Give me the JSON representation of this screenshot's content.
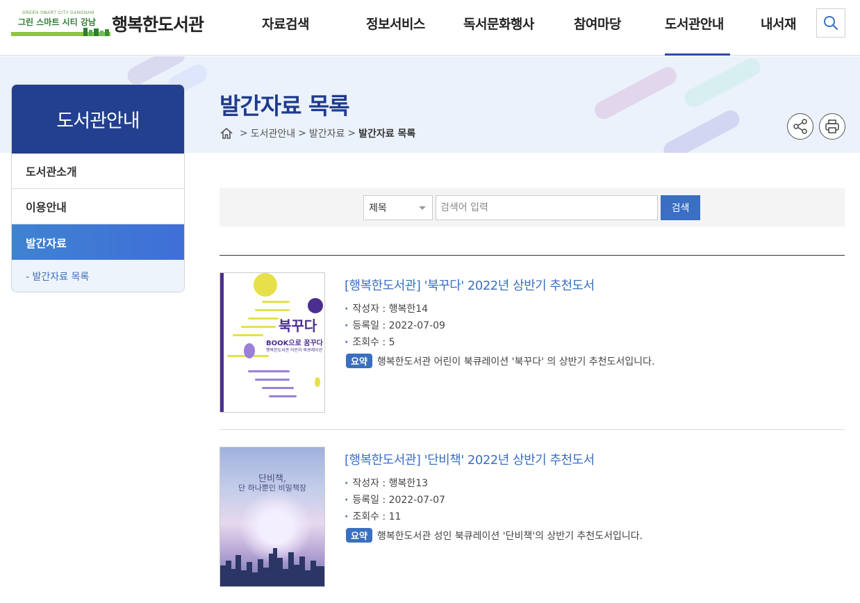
{
  "header": {
    "logo_sub": "GREEN SMART CITY GANGNAM",
    "logo_badge": "그린 스마트 시티 강남",
    "logo_name": "행복한도서관",
    "nav": [
      {
        "label": "자료검색"
      },
      {
        "label": "정보서비스"
      },
      {
        "label": "독서문화행사"
      },
      {
        "label": "참여마당"
      },
      {
        "label": "도서관안내"
      },
      {
        "label": "내서재"
      }
    ],
    "active_nav": "도서관안내"
  },
  "banner": {
    "title": "발간자료 목록",
    "breadcrumb": [
      "도서관안내",
      "발간자료",
      "발간자료 목록"
    ]
  },
  "sidebar": {
    "title": "도서관안내",
    "items": [
      {
        "label": "도서관소개"
      },
      {
        "label": "이용안내"
      },
      {
        "label": "발간자료"
      }
    ],
    "sub_item": "- 발간자료 목록"
  },
  "search": {
    "select_value": "제목",
    "placeholder": "검색어 입력",
    "button": "검색"
  },
  "list": [
    {
      "title": "[행복한도서관] '북꾸다' 2022년 상반기 추천도서",
      "author": "작성자 : 행복한14",
      "date": "등록일 : 2022-07-09",
      "views": "조회수 : 5",
      "badge": "요약",
      "summary": "행복한도서관 어린이 북큐레이션 '북꾸다' 의 상반기 추천도서입니다.",
      "cover_big": "북꾸다",
      "cover_line1": "BOOK으로 꿈꾸다",
      "cover_line2": "행복한도서관 어린이 북큐레이션"
    },
    {
      "title": "[행복한도서관] '단비책' 2022년 상반기 추천도서",
      "author": "작성자 : 행복한13",
      "date": "등록일 : 2022-07-07",
      "views": "조회수 : 11",
      "badge": "요약",
      "summary": "행복한도서관 성인 북큐레이션 '단비책'의 상반기 추천도서입니다.",
      "cover_line1": "단비책,",
      "cover_line2": "단 하나뿐인 비밀책장"
    }
  ],
  "colors": {
    "primary": "#22408f",
    "accent": "#3a6fc1",
    "banner_bg": "#ebf2fb"
  }
}
